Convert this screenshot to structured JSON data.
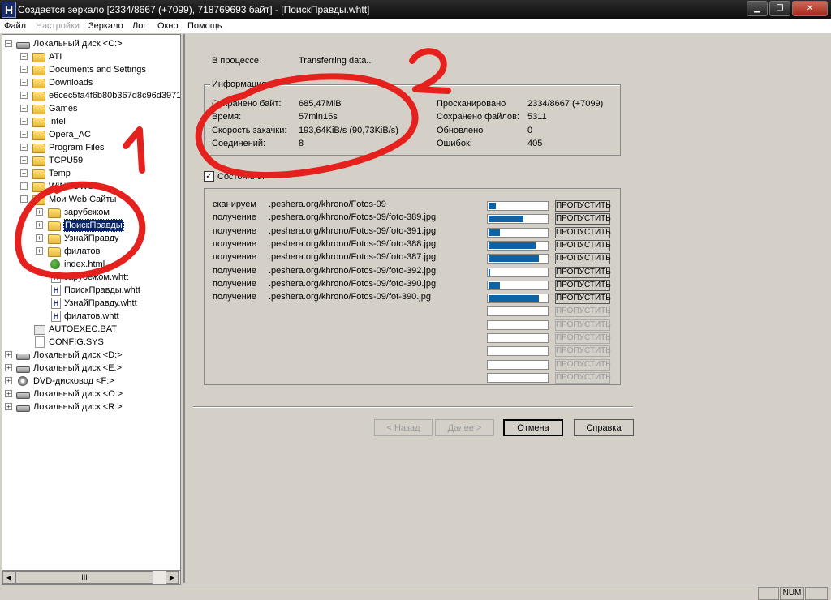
{
  "titlebar": {
    "app_icon": "H",
    "title": "Создается зеркало [2334/8667 (+7099), 718769693 байт] - [ПоискПравды.whtt]",
    "minimize": "▁",
    "restore": "❐",
    "close": "✕"
  },
  "menu": [
    "Файл",
    "Настройки",
    "Зеркало",
    "Лог",
    "Окно",
    "Помощь"
  ],
  "tree": {
    "drive_c": "Локальный диск <C:>",
    "items": [
      "ATI",
      "Documents and Settings",
      "Downloads",
      "e6cec5fa4f6b80b367d8c96d3971",
      "Games",
      "Intel",
      "Opera_AC",
      "Program Files",
      "TCPU59",
      "Temp",
      "WINDOWS",
      "Мои Web Сайты",
      "зарубежом",
      "ПоискПравды",
      "УзнайПравду",
      "филатов",
      "index.html",
      "зарубежом.whtt",
      "ПоискПравды.whtt",
      "УзнайПравду.whtt",
      "филатов.whtt",
      "AUTOEXEC.BAT",
      "CONFIG.SYS"
    ],
    "drives": [
      "Локальный диск <D:>",
      "Локальный диск <E:>",
      "DVD-дисковод <F:>",
      "Локальный диск <O:>",
      "Локальный диск <R:>"
    ],
    "scroll_thumb": "III"
  },
  "main": {
    "in_process_label": "В процессе:",
    "in_process_value": "Transferring data..",
    "info_title": "Информация",
    "info_left": [
      {
        "label": "Сохранено байт:",
        "value": "685,47MiB"
      },
      {
        "label": "Время:",
        "value": "57min15s"
      },
      {
        "label": "Скорость закачки:",
        "value": "193,64KiB/s (90,73KiB/s)"
      },
      {
        "label": "Соединений:",
        "value": "8"
      }
    ],
    "info_right": [
      {
        "label": "Просканировано",
        "value": "2334/8667 (+7099)"
      },
      {
        "label": "Сохранено файлов:",
        "value": "5311"
      },
      {
        "label": "Обновлено",
        "value": "0"
      },
      {
        "label": "Ошибок:",
        "value": "405"
      }
    ],
    "state_checkbox": "✓",
    "state_label": "Состояние:",
    "skip_label": "ПРОПУСТИТЬ",
    "transfers": [
      {
        "action": "сканируем",
        "url": ".peshera.org/khrono/Fotos-09",
        "progress": 0.12
      },
      {
        "action": "получение",
        "url": ".peshera.org/khrono/Fotos-09/foto-389.jpg",
        "progress": 0.6
      },
      {
        "action": "получение",
        "url": ".peshera.org/khrono/Fotos-09/foto-391.jpg",
        "progress": 0.2
      },
      {
        "action": "получение",
        "url": ".peshera.org/khrono/Fotos-09/foto-388.jpg",
        "progress": 0.8
      },
      {
        "action": "получение",
        "url": ".peshera.org/khrono/Fotos-09/foto-387.jpg",
        "progress": 0.86
      },
      {
        "action": "получение",
        "url": ".peshera.org/khrono/Fotos-09/foto-392.jpg",
        "progress": 0.03
      },
      {
        "action": "получение",
        "url": ".peshera.org/khrono/Fotos-09/foto-390.jpg",
        "progress": 0.2
      },
      {
        "action": "получение",
        "url": ".peshera.org/khrono/Fotos-09/fot-390.jpg",
        "progress": 0.86
      }
    ],
    "empty_slots": 6,
    "back": "< Назад",
    "next": "Далее >",
    "cancel": "Отмена",
    "help": "Справка"
  },
  "annotations": [
    "1",
    "2"
  ],
  "statusbar": {
    "num": "NUM"
  }
}
